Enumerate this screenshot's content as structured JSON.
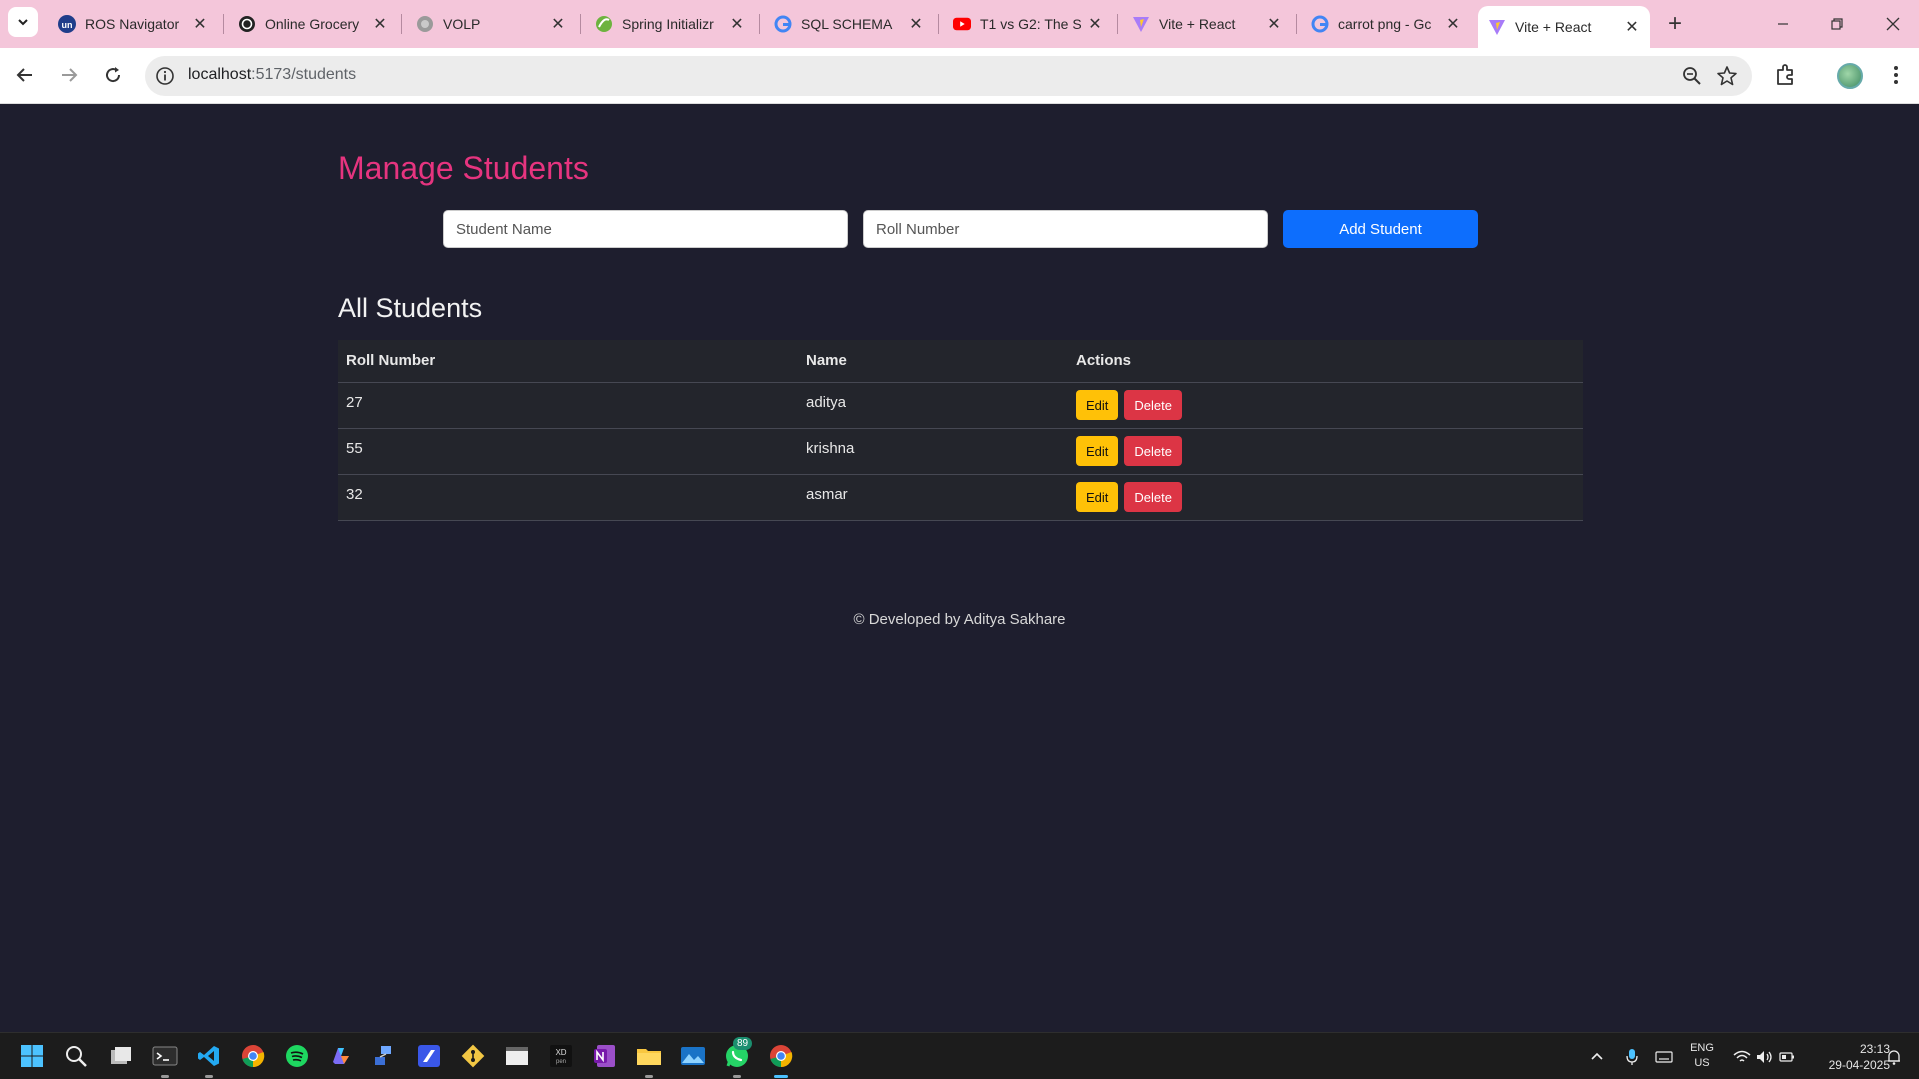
{
  "browser": {
    "tabs": [
      {
        "title": "ROS Navigator",
        "icon": "un-logo-icon"
      },
      {
        "title": "Online Grocery",
        "icon": "openai-logo-icon"
      },
      {
        "title": "VOLP",
        "icon": "globe-icon"
      },
      {
        "title": "Spring Initializr",
        "icon": "spring-logo-icon"
      },
      {
        "title": "SQL SCHEMA",
        "icon": "google-logo-icon"
      },
      {
        "title": "T1 vs G2: The S",
        "icon": "youtube-logo-icon"
      },
      {
        "title": "Vite + React",
        "icon": "vite-logo-icon"
      },
      {
        "title": "carrot png - Gc",
        "icon": "google-logo-icon"
      },
      {
        "title": "Vite + React",
        "icon": "vite-logo-icon",
        "active": true
      }
    ],
    "url_host": "localhost",
    "url_path": ":5173/students"
  },
  "page": {
    "heading": "Manage Students",
    "name_placeholder": "Student Name",
    "roll_placeholder": "Roll Number",
    "add_button": "Add Student",
    "list_heading": "All Students",
    "columns": [
      "Roll Number",
      "Name",
      "Actions"
    ],
    "rows": [
      {
        "roll": "27",
        "name": "aditya"
      },
      {
        "roll": "55",
        "name": "krishna"
      },
      {
        "roll": "32",
        "name": "asmar"
      }
    ],
    "edit_label": "Edit",
    "delete_label": "Delete",
    "footer": "© Developed by Aditya Sakhare"
  },
  "colors": {
    "page_bg": "#1e1e2e",
    "heading": "#e6347f",
    "primary": "#0d6efd",
    "warning": "#ffc107",
    "danger": "#dc3545",
    "tabstrip": "#f4c6da"
  },
  "taskbar": {
    "whatsapp_badge": "89",
    "lang_top": "ENG",
    "lang_bottom": "US",
    "time": "23:13",
    "date": "29-04-2025"
  }
}
